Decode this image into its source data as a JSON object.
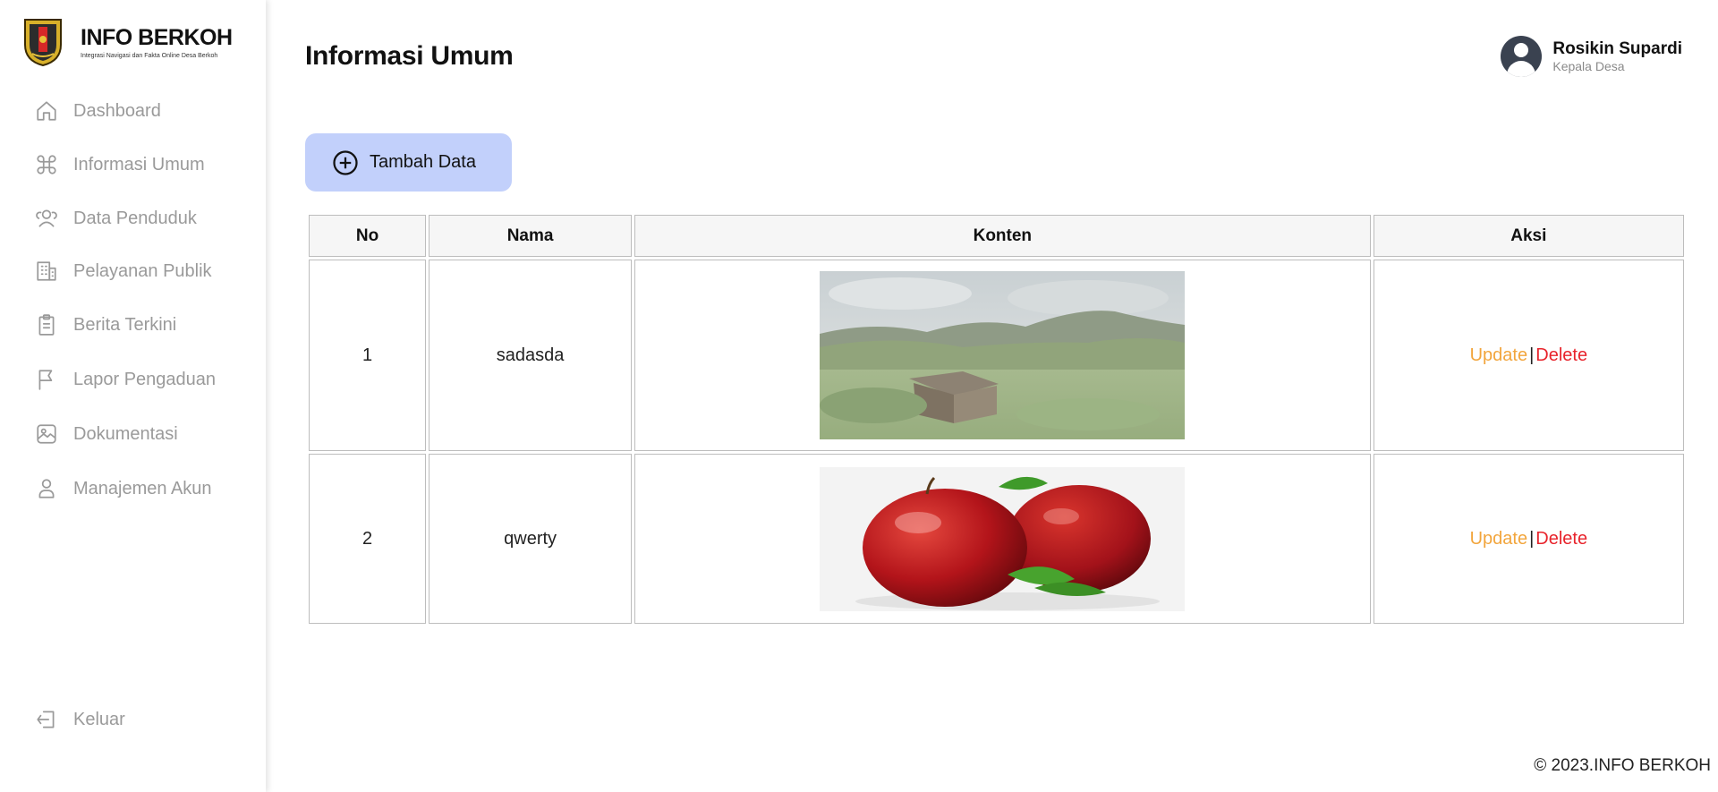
{
  "brand": {
    "title": "INFO BERKOH",
    "subtitle": "Integrasi Navigasi dan Fakta Online Desa Berkoh",
    "logo_icon": "regency-crest-icon"
  },
  "nav": [
    {
      "label": "Dashboard",
      "icon": "home-icon"
    },
    {
      "label": "Informasi Umum",
      "icon": "command-icon"
    },
    {
      "label": "Data Penduduk",
      "icon": "users-icon"
    },
    {
      "label": "Pelayanan Publik",
      "icon": "building-icon"
    },
    {
      "label": "Berita Terkini",
      "icon": "clipboard-icon"
    },
    {
      "label": "Lapor Pengaduan",
      "icon": "flag-icon"
    },
    {
      "label": "Dokumentasi",
      "icon": "image-icon"
    },
    {
      "label": "Manajemen Akun",
      "icon": "user-icon"
    }
  ],
  "logout": {
    "label": "Keluar",
    "icon": "logout-icon"
  },
  "page": {
    "title": "Informasi Umum"
  },
  "user": {
    "name": "Rosikin Supardi",
    "role": "Kepala Desa"
  },
  "actions": {
    "add_label": "Tambah Data"
  },
  "table": {
    "headers": [
      "No",
      "Nama",
      "Konten",
      "Aksi"
    ],
    "rows": [
      {
        "no": "1",
        "nama": "sadasda",
        "konten": "landscape-photo",
        "update": "Update",
        "sep": "|",
        "delete": "Delete"
      },
      {
        "no": "2",
        "nama": "qwerty",
        "konten": "apples-photo",
        "update": "Update",
        "sep": "|",
        "delete": "Delete"
      }
    ]
  },
  "footer": {
    "text": "© 2023.INFO BERKOH"
  },
  "colors": {
    "accent_button": "#c2d0fb",
    "update": "#f2a53c",
    "delete": "#e8232b",
    "nav_text": "#9a9a9a"
  }
}
